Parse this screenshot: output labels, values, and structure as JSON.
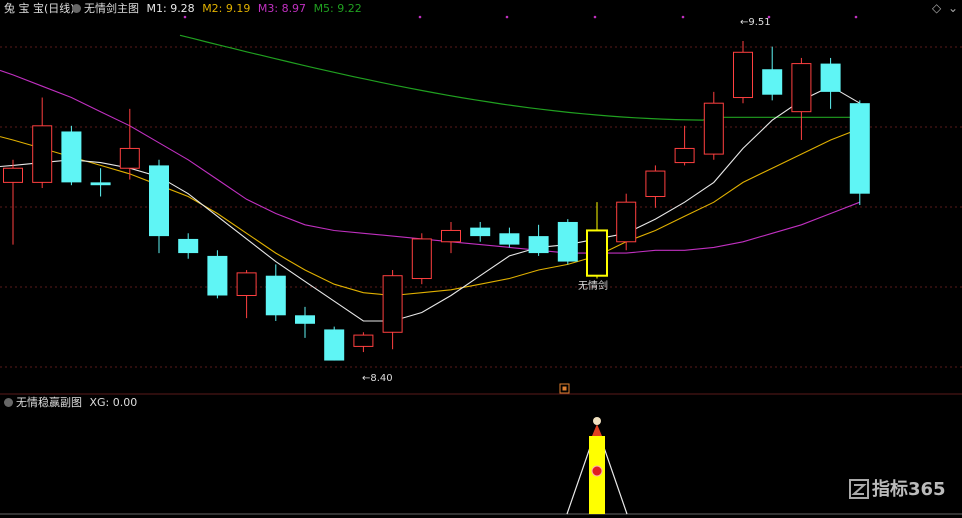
{
  "header": {
    "app_title": "兔 宝 宝(日线)",
    "main_indicator": "无情剑主图",
    "m1_label": "M1: 9.28",
    "m2_label": "M2: 9.19",
    "m3_label": "M3: 8.97",
    "m5_label": "M5: 9.22",
    "settings_icon": "diamond-icon"
  },
  "colors": {
    "up": "#ff4040",
    "down": "#5ff5f5",
    "m1": "#e8e8e8",
    "m2": "#e0b000",
    "m3": "#c030c0",
    "m5": "#20a020",
    "signal": "#ffff00",
    "grid": "#5a1a1a"
  },
  "annotations": {
    "high_label": "9.51",
    "low_label": "8.40",
    "signal_label": "无情剑"
  },
  "sub_panel": {
    "title": "无情稳赢副图",
    "xg_label": "XG: 0.00"
  },
  "watermark": {
    "text": "指标365"
  },
  "chart_data": {
    "type": "candlestick",
    "y_range": [
      8.28,
      9.56
    ],
    "candles": [
      {
        "o": 9.0,
        "c": 9.05,
        "h": 9.08,
        "l": 8.78,
        "up": true
      },
      {
        "o": 9.0,
        "c": 9.2,
        "h": 9.3,
        "l": 8.98,
        "up": true
      },
      {
        "o": 9.18,
        "c": 9.0,
        "h": 9.2,
        "l": 8.99,
        "up": false
      },
      {
        "o": 9.0,
        "c": 8.99,
        "h": 9.05,
        "l": 8.95,
        "up": false
      },
      {
        "o": 9.05,
        "c": 9.12,
        "h": 9.26,
        "l": 9.01,
        "up": true
      },
      {
        "o": 9.06,
        "c": 8.81,
        "h": 9.08,
        "l": 8.75,
        "up": false
      },
      {
        "o": 8.8,
        "c": 8.75,
        "h": 8.82,
        "l": 8.73,
        "up": false
      },
      {
        "o": 8.74,
        "c": 8.6,
        "h": 8.76,
        "l": 8.59,
        "up": false
      },
      {
        "o": 8.6,
        "c": 8.68,
        "h": 8.69,
        "l": 8.52,
        "up": true
      },
      {
        "o": 8.67,
        "c": 8.53,
        "h": 8.71,
        "l": 8.51,
        "up": false
      },
      {
        "o": 8.53,
        "c": 8.5,
        "h": 8.56,
        "l": 8.45,
        "up": false
      },
      {
        "o": 8.48,
        "c": 8.37,
        "h": 8.49,
        "l": 8.37,
        "up": false
      },
      {
        "o": 8.42,
        "c": 8.46,
        "h": 8.47,
        "l": 8.4,
        "up": true
      },
      {
        "o": 8.47,
        "c": 8.67,
        "h": 8.69,
        "l": 8.41,
        "up": true
      },
      {
        "o": 8.66,
        "c": 8.8,
        "h": 8.82,
        "l": 8.64,
        "up": true
      },
      {
        "o": 8.79,
        "c": 8.83,
        "h": 8.86,
        "l": 8.75,
        "up": true
      },
      {
        "o": 8.84,
        "c": 8.81,
        "h": 8.86,
        "l": 8.79,
        "up": false
      },
      {
        "o": 8.82,
        "c": 8.78,
        "h": 8.84,
        "l": 8.77,
        "up": false
      },
      {
        "o": 8.81,
        "c": 8.75,
        "h": 8.85,
        "l": 8.74,
        "up": false
      },
      {
        "o": 8.86,
        "c": 8.72,
        "h": 8.87,
        "l": 8.71,
        "up": false
      },
      {
        "o": 8.67,
        "c": 8.83,
        "h": 8.93,
        "l": 8.66,
        "up": false,
        "signal": true
      },
      {
        "o": 8.79,
        "c": 8.93,
        "h": 8.96,
        "l": 8.76,
        "up": true
      },
      {
        "o": 8.95,
        "c": 9.04,
        "h": 9.06,
        "l": 8.91,
        "up": true
      },
      {
        "o": 9.07,
        "c": 9.12,
        "h": 9.2,
        "l": 9.06,
        "up": true
      },
      {
        "o": 9.1,
        "c": 9.28,
        "h": 9.32,
        "l": 9.08,
        "up": true
      },
      {
        "o": 9.3,
        "c": 9.46,
        "h": 9.5,
        "l": 9.28,
        "up": true
      },
      {
        "o": 9.4,
        "c": 9.31,
        "h": 9.48,
        "l": 9.29,
        "up": false
      },
      {
        "o": 9.25,
        "c": 9.42,
        "h": 9.44,
        "l": 9.15,
        "up": true
      },
      {
        "o": 9.42,
        "c": 9.32,
        "h": 9.44,
        "l": 9.26,
        "up": false
      },
      {
        "o": 9.28,
        "c": 8.96,
        "h": 9.29,
        "l": 8.92,
        "up": false
      }
    ],
    "m1": [
      9.06,
      9.07,
      9.08,
      9.07,
      9.05,
      9.02,
      8.96,
      8.88,
      8.8,
      8.72,
      8.65,
      8.58,
      8.51,
      8.51,
      8.54,
      8.6,
      8.67,
      8.74,
      8.77,
      8.78,
      8.8,
      8.82,
      8.87,
      8.93,
      9.0,
      9.12,
      9.22,
      9.29,
      9.34,
      9.28
    ],
    "m2": [
      9.15,
      9.12,
      9.09,
      9.06,
      9.03,
      8.99,
      8.95,
      8.89,
      8.82,
      8.75,
      8.69,
      8.64,
      8.61,
      8.6,
      8.61,
      8.62,
      8.64,
      8.66,
      8.69,
      8.71,
      8.74,
      8.79,
      8.83,
      8.88,
      8.93,
      9.0,
      9.05,
      9.1,
      9.15,
      9.19
    ],
    "m3": [
      9.38,
      9.34,
      9.3,
      9.25,
      9.2,
      9.14,
      9.08,
      9.01,
      8.94,
      8.89,
      8.85,
      8.83,
      8.82,
      8.81,
      8.8,
      8.79,
      8.78,
      8.77,
      8.76,
      8.75,
      8.75,
      8.75,
      8.76,
      8.76,
      8.77,
      8.79,
      8.82,
      8.85,
      8.89,
      8.93
    ]
  }
}
